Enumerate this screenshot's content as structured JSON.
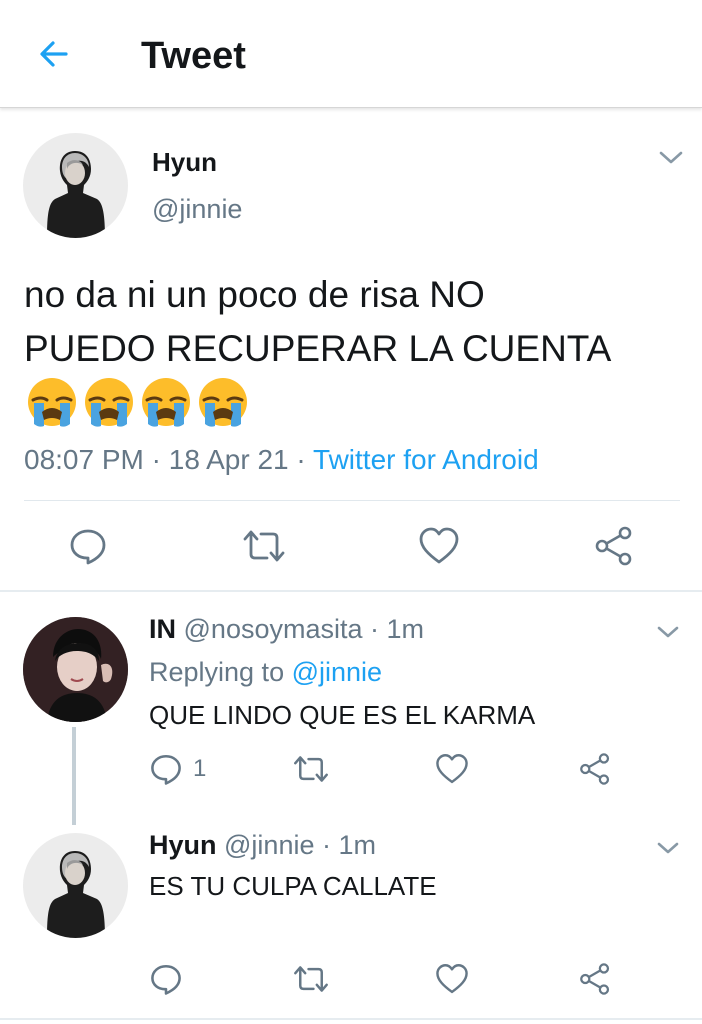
{
  "header": {
    "title": "Tweet",
    "back_icon": "arrow-left-icon",
    "accent": "#1da1f2"
  },
  "tweet": {
    "name": "Hyun",
    "handle": "@jinnie",
    "text": "no da ni un poco de risa NO\nPUEDO RECUPERAR LA CUENTA",
    "emoji": [
      "loudly-crying-face",
      "loudly-crying-face",
      "loudly-crying-face",
      "loudly-crying-face"
    ],
    "time": "08:07 PM",
    "separator": " · ",
    "date": "18 Apr 21",
    "source": "Twitter for Android",
    "actions": [
      "reply-icon",
      "retweet-icon",
      "like-icon",
      "share-icon"
    ]
  },
  "replies": [
    {
      "name": "IN",
      "handle": "@nosoymasita",
      "time": "1m",
      "replying_prefix": "Replying to ",
      "replying_to": "@jinnie",
      "text": "QUE LINDO QUE ES EL KARMA",
      "reply_count": "1"
    },
    {
      "name": "Hyun",
      "handle": "@jinnie",
      "time": "1m",
      "text": "ES TU CULPA CALLATE",
      "reply_count": ""
    }
  ],
  "colors": {
    "text": "#14171a",
    "secondary": "#657786",
    "link": "#1da1f2",
    "divider": "#e1e8ed"
  }
}
